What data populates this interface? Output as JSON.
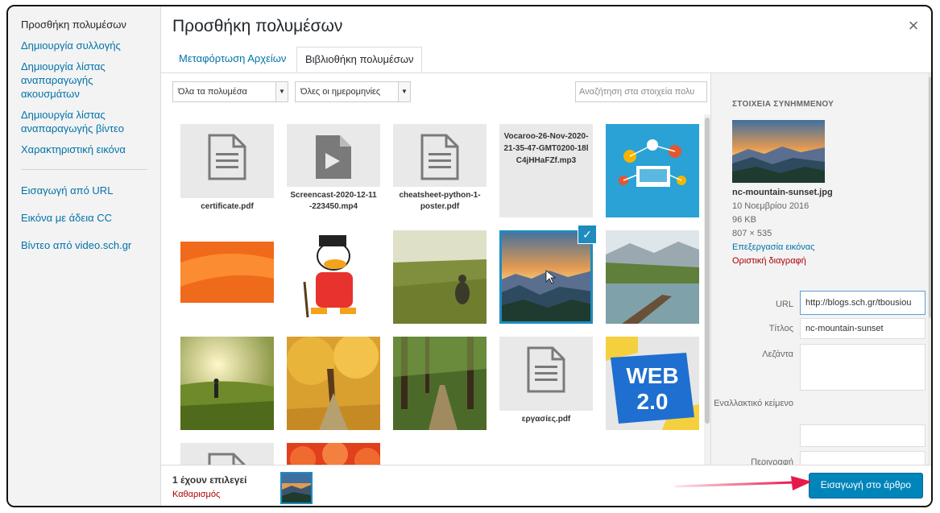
{
  "menu": {
    "items": [
      {
        "label": "Προσθήκη πολυμέσων",
        "active": true
      },
      {
        "label": "Δημιουργία συλλογής"
      },
      {
        "label": "Δημιουργία λίστας αναπαραγωγής ακουσμάτων"
      },
      {
        "label": "Δημιουργία λίστας αναπαραγωγής βίντεο"
      },
      {
        "label": "Χαρακτηριστική εικόνα"
      }
    ],
    "items2": [
      {
        "label": "Εισαγωγή από URL"
      },
      {
        "label": "Εικόνα με άδεια CC"
      },
      {
        "label": "Βίντεο από video.sch.gr"
      }
    ]
  },
  "modal": {
    "title": "Προσθήκη πολυμέσων",
    "close_glyph": "×",
    "tabs": [
      {
        "label": "Μεταφόρτωση Αρχείων"
      },
      {
        "label": "Βιβλιοθήκη πολυμέσων",
        "active": true
      }
    ]
  },
  "toolbar": {
    "filter_type": "Όλα τα πολυμέσα",
    "filter_date": "Όλες οι ημερομηνίες",
    "search_placeholder": "Αναζήτηση στα στοιχεία πολυ"
  },
  "library": {
    "tiles": [
      {
        "kind": "doc",
        "name": "certificate.pdf"
      },
      {
        "kind": "video",
        "name": "Screencast-2020-12-11-223450.mp4"
      },
      {
        "kind": "doc",
        "name": "cheatsheet-python-1-poster.pdf"
      },
      {
        "kind": "audio",
        "name": "Vocaroo-26-Nov-2020-21-35-47-GMT0200-18lC4jHHaFZf.mp3"
      },
      {
        "kind": "image",
        "scene": "tech"
      },
      {
        "kind": "image",
        "scene": "orange"
      },
      {
        "kind": "image",
        "scene": "cartoon"
      },
      {
        "kind": "image",
        "scene": "meadow"
      },
      {
        "kind": "image",
        "scene": "mountains",
        "selected": true
      },
      {
        "kind": "image",
        "scene": "lake"
      },
      {
        "kind": "image",
        "scene": "sunset-walk"
      },
      {
        "kind": "image",
        "scene": "autumn"
      },
      {
        "kind": "image",
        "scene": "forest"
      },
      {
        "kind": "doc",
        "name": "εργασίες.pdf"
      },
      {
        "kind": "image",
        "scene": "web20"
      },
      {
        "kind": "doc",
        "name": ""
      },
      {
        "kind": "image",
        "scene": "red-petals"
      }
    ],
    "check_glyph": "✓"
  },
  "details": {
    "heading": "ΣΤΟΙΧΕΙΑ ΣΥΝΗΜΜΕΝΟΥ",
    "filename": "nc-mountain-sunset.jpg",
    "date": "10 Νοεμβρίου 2016",
    "size": "96 KB",
    "dimensions": "807 × 535",
    "edit_link": "Επεξεργασία εικόνας",
    "delete_link": "Οριστική διαγραφή",
    "fields": {
      "url_label": "URL",
      "url_value": "http://blogs.sch.gr/tbousiou",
      "title_label": "Τίτλος",
      "title_value": "nc-mountain-sunset",
      "caption_label": "Λεζάντα",
      "caption_value": "",
      "alt_label": "Εναλλακτικό κείμενο",
      "alt_value": "",
      "description_label": "Περιγραφή"
    }
  },
  "footer": {
    "selected_count": "1 έχουν επιλεγεί",
    "clear_label": "Καθαρισμός",
    "insert_button": "Εισαγωγή στο άρθρο"
  },
  "colors": {
    "accent": "#0085ba",
    "link": "#0073aa",
    "danger": "#a00000",
    "annotation_arrow": "#e6194b"
  }
}
